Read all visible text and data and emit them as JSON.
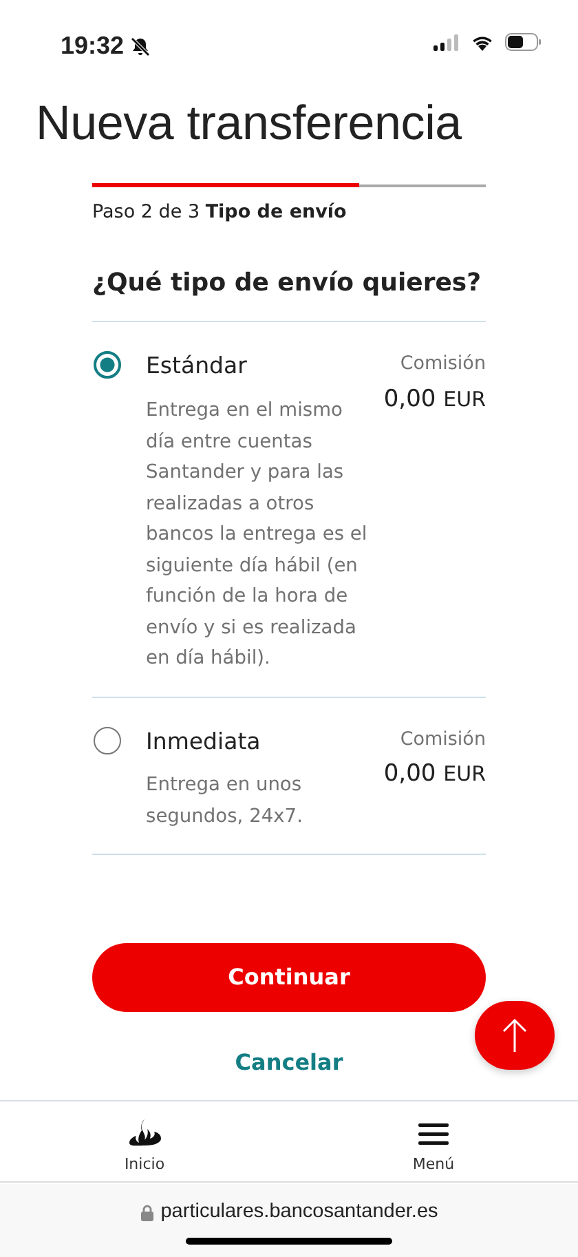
{
  "status_bar": {
    "time": "19:32"
  },
  "title": "Nueva transferencia",
  "progress": {
    "level": 0.68,
    "step": "Paso 2 de 3",
    "step_name": "Tipo de envío"
  },
  "question": "¿Qué tipo de envío quieres?",
  "options": [
    {
      "label": "Estándar",
      "selected": true,
      "description": "Entrega en el mismo día entre cuentas Santander y para las realizadas a otros bancos la entrega es el siguiente día hábil (en función de la hora de envío y si es realizada en día hábil).",
      "fee_label": "Comisión",
      "fee_amount": "0,00",
      "fee_currency": "EUR"
    },
    {
      "label": "Inmediata",
      "selected": false,
      "description": "Entrega en unos segundos, 24x7.",
      "fee_label": "Comisión",
      "fee_amount": "0,00",
      "fee_currency": "EUR"
    }
  ],
  "primary_button": "Continuar",
  "cancel_link": "Cancelar",
  "bottom_nav": [
    {
      "label": "Inicio",
      "kind": "home"
    },
    {
      "label": "Menú",
      "kind": "menu"
    }
  ],
  "url": "particulares.bancosantander.es"
}
